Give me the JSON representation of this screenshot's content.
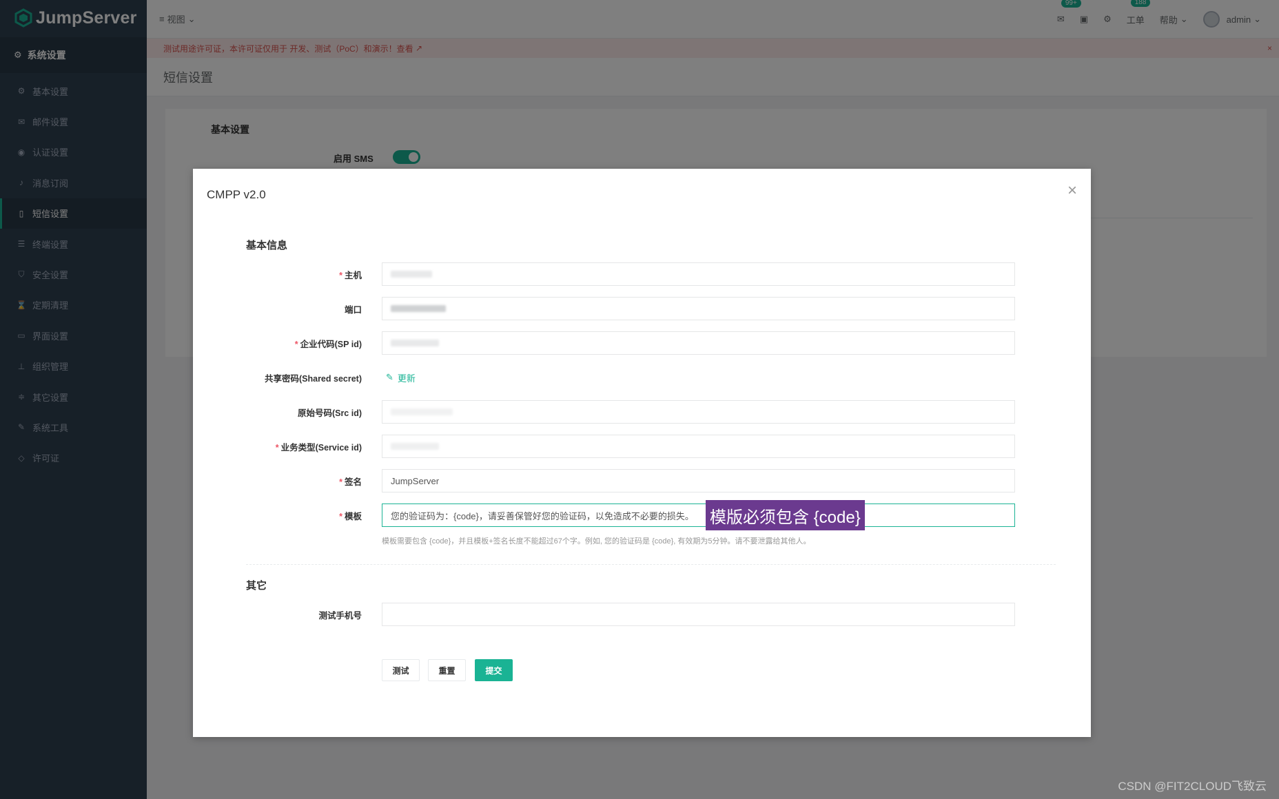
{
  "app": {
    "brand": "JumpServer"
  },
  "sidebar": {
    "header": "系统设置",
    "items": [
      {
        "label": "基本设置",
        "icon": "gear-icon"
      },
      {
        "label": "邮件设置",
        "icon": "envelope-icon"
      },
      {
        "label": "认证设置",
        "icon": "user-circle-icon"
      },
      {
        "label": "消息订阅",
        "icon": "bell-icon"
      },
      {
        "label": "短信设置",
        "icon": "mobile-icon",
        "active": true
      },
      {
        "label": "终端设置",
        "icon": "list-icon"
      },
      {
        "label": "安全设置",
        "icon": "shield-icon"
      },
      {
        "label": "定期清理",
        "icon": "hourglass-icon"
      },
      {
        "label": "界面设置",
        "icon": "laptop-icon"
      },
      {
        "label": "组织管理",
        "icon": "sitemap-icon"
      },
      {
        "label": "其它设置",
        "icon": "sliders-icon"
      },
      {
        "label": "系统工具",
        "icon": "wrench-icon"
      },
      {
        "label": "许可证",
        "icon": "diamond-icon"
      }
    ]
  },
  "topbar": {
    "view": "视图",
    "mail_badge": "99+",
    "ticket_badge": "188",
    "ticket": "工单",
    "help": "帮助",
    "user": "admin"
  },
  "license_notice": {
    "text": "测试用途许可证，本许可证仅用于 开发、测试（PoC）和演示！查看",
    "close": "×"
  },
  "page": {
    "title": "短信设置"
  },
  "background_card": {
    "section": "基本设置",
    "enable_sms_label": "启用 SMS",
    "enable_sms": true
  },
  "modal": {
    "title": "CMPP v2.0",
    "close": "×",
    "section_basic": "基本信息",
    "section_other": "其它",
    "fields": {
      "host": {
        "label": "主机",
        "required": true
      },
      "port": {
        "label": "端口",
        "required": false
      },
      "sp_id": {
        "label": "企业代码(SP id)",
        "required": true
      },
      "shared_secret": {
        "label": "共享密码(Shared secret)",
        "link": "更新"
      },
      "src_id": {
        "label": "原始号码(Src id)",
        "required": false
      },
      "service_id": {
        "label": "业务类型(Service id)",
        "required": true
      },
      "sign": {
        "label": "签名",
        "required": true,
        "value": "JumpServer"
      },
      "template": {
        "label": "模板",
        "required": true,
        "value": "您的验证码为：{code}，请妥善保管好您的验证码，以免造成不必要的损失。"
      },
      "test_phone": {
        "label": "测试手机号",
        "value": ""
      }
    },
    "template_help": "模板需要包含 {code}，并且模板+签名长度不能超过67个字。例如, 您的验证码是 {code}, 有效期为5分钟。请不要泄露给其他人。",
    "annotation": "模版必须包含 {code}",
    "buttons": {
      "test": "测试",
      "reset": "重置",
      "submit": "提交"
    }
  },
  "watermark": "CSDN @FIT2CLOUD飞致云"
}
